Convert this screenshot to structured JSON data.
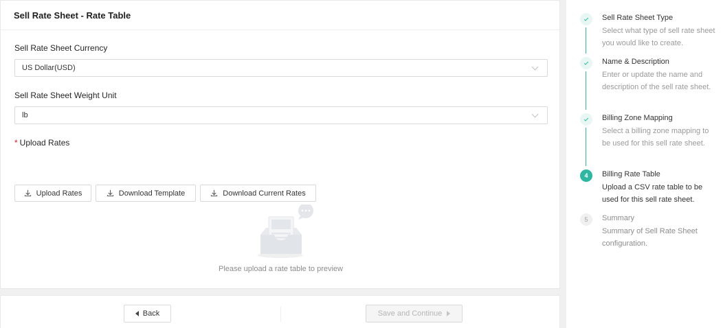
{
  "header": {
    "title": "Sell Rate Sheet - Rate Table"
  },
  "currency": {
    "label": "Sell Rate Sheet Currency",
    "value": "US Dollar(USD)"
  },
  "weight": {
    "label": "Sell Rate Sheet Weight Unit",
    "value": "lb"
  },
  "upload": {
    "required_mark": "*",
    "label": "Upload Rates",
    "buttons": {
      "upload": "Upload Rates",
      "template": "Download Template",
      "current": "Download Current Rates"
    },
    "empty_text": "Please upload a rate table to preview"
  },
  "footer": {
    "back": "Back",
    "save": "Save and Continue"
  },
  "steps": [
    {
      "number": "1",
      "status": "done",
      "title": "Sell Rate Sheet Type",
      "desc": "Select what type of sell rate sheet you would like to create."
    },
    {
      "number": "2",
      "status": "done",
      "title": "Name & Description",
      "desc": "Enter or update the name and description of the sell rate sheet."
    },
    {
      "number": "3",
      "status": "done",
      "title": "Billing Zone Mapping",
      "desc": "Select a billing zone mapping to be used for this sell rate sheet."
    },
    {
      "number": "4",
      "status": "active",
      "title": "Billing Rate Table",
      "desc": "Upload a CSV rate table to be used for this sell rate sheet."
    },
    {
      "number": "5",
      "status": "wait",
      "title": "Summary",
      "desc": "Summary of Sell Rate Sheet configuration."
    }
  ],
  "colors": {
    "accent": "#2db7a0",
    "required": "#e02020",
    "border": "#d9d9d9"
  },
  "icons": [
    "download-icon",
    "caret-left-icon",
    "caret-right-icon",
    "chevron-down-icon",
    "check-icon",
    "empty-inbox-icon"
  ]
}
